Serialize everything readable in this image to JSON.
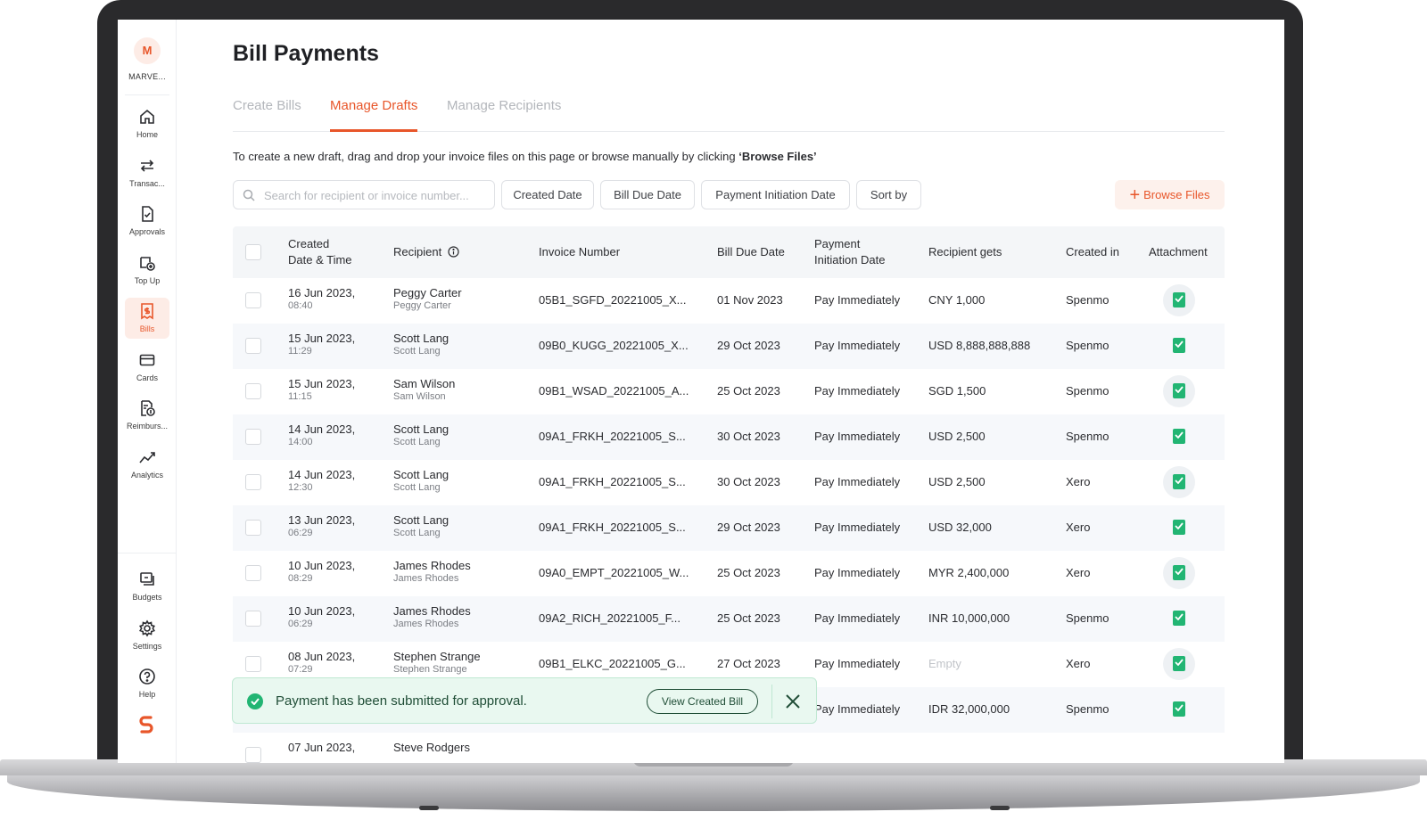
{
  "org": {
    "initial": "M",
    "name": "MARVE..."
  },
  "sidebar": {
    "items": [
      {
        "label": "Home",
        "icon": "home-icon"
      },
      {
        "label": "Transac...",
        "icon": "transactions-icon"
      },
      {
        "label": "Approvals",
        "icon": "approvals-icon"
      },
      {
        "label": "Top Up",
        "icon": "top-up-icon"
      },
      {
        "label": "Bills",
        "icon": "bills-icon",
        "active": true
      },
      {
        "label": "Cards",
        "icon": "card-icon"
      },
      {
        "label": "Reimburs...",
        "icon": "reimbursement-icon"
      },
      {
        "label": "Analytics",
        "icon": "analytics-icon"
      }
    ],
    "bottom_items": [
      {
        "label": "Budgets",
        "icon": "budgets-icon"
      },
      {
        "label": "Settings",
        "icon": "gear-icon"
      },
      {
        "label": "Help",
        "icon": "help-icon"
      }
    ]
  },
  "page": {
    "title": "Bill Payments"
  },
  "tabs": [
    {
      "label": "Create Bills"
    },
    {
      "label": "Manage Drafts",
      "active": true
    },
    {
      "label": "Manage Recipients"
    }
  ],
  "hint": {
    "text": "To create a new draft, drag and drop your invoice files on this page or browse manually by clicking ",
    "emphasis": "‘Browse Files’"
  },
  "filters": {
    "search_placeholder": "Search for recipient or invoice number...",
    "chips": [
      "Created Date",
      "Bill Due Date",
      "Payment Initiation Date",
      "Sort by"
    ],
    "browse_label": "Browse Files"
  },
  "table": {
    "headers": {
      "created_line1": "Created",
      "created_line2": "Date & Time",
      "recipient": "Recipient",
      "invoice": "Invoice Number",
      "due": "Bill Due Date",
      "payment_line1": "Payment",
      "payment_line2": "Initiation Date",
      "gets": "Recipient gets",
      "created_in": "Created in",
      "attachment": "Attachment"
    },
    "rows": [
      {
        "date": "16 Jun 2023,",
        "time": "08:40",
        "recipient": "Peggy Carter",
        "recipient_sub": "Peggy Carter",
        "invoice": "05B1_SGFD_20221005_X...",
        "due": "01 Nov 2023",
        "payment": "Pay Immediately",
        "gets": "CNY 1,000",
        "created_in": "Spenmo"
      },
      {
        "date": "15 Jun 2023,",
        "time": "11:29",
        "recipient": "Scott Lang",
        "recipient_sub": "Scott Lang",
        "invoice": "09B0_KUGG_20221005_X...",
        "due": "29 Oct 2023",
        "payment": "Pay Immediately",
        "gets": "USD 8,888,888,888",
        "created_in": "Spenmo"
      },
      {
        "date": "15 Jun 2023,",
        "time": "11:15",
        "recipient": "Sam Wilson",
        "recipient_sub": "Sam Wilson",
        "invoice": "09B1_WSAD_20221005_A...",
        "due": "25 Oct 2023",
        "payment": "Pay Immediately",
        "gets": "SGD 1,500",
        "created_in": "Spenmo"
      },
      {
        "date": "14 Jun 2023,",
        "time": "14:00",
        "recipient": "Scott Lang",
        "recipient_sub": "Scott Lang",
        "invoice": "09A1_FRKH_20221005_S...",
        "due": "30 Oct 2023",
        "payment": "Pay Immediately",
        "gets": "USD 2,500",
        "created_in": "Spenmo"
      },
      {
        "date": "14 Jun 2023,",
        "time": "12:30",
        "recipient": "Scott Lang",
        "recipient_sub": "Scott Lang",
        "invoice": "09A1_FRKH_20221005_S...",
        "due": "30 Oct 2023",
        "payment": "Pay Immediately",
        "gets": "USD 2,500",
        "created_in": "Xero"
      },
      {
        "date": "13 Jun 2023,",
        "time": "06:29",
        "recipient": "Scott Lang",
        "recipient_sub": "Scott Lang",
        "invoice": "09A1_FRKH_20221005_S...",
        "due": "29 Oct 2023",
        "payment": "Pay Immediately",
        "gets": "USD 32,000",
        "created_in": "Xero"
      },
      {
        "date": "10 Jun 2023,",
        "time": "08:29",
        "recipient": "James Rhodes",
        "recipient_sub": "James Rhodes",
        "invoice": "09A0_EMPT_20221005_W...",
        "due": "25 Oct 2023",
        "payment": "Pay Immediately",
        "gets": "MYR 2,400,000",
        "created_in": "Xero"
      },
      {
        "date": "10 Jun 2023,",
        "time": "06:29",
        "recipient": "James Rhodes",
        "recipient_sub": "James Rhodes",
        "invoice": "09A2_RICH_20221005_F...",
        "due": "25 Oct 2023",
        "payment": "Pay Immediately",
        "gets": "INR 10,000,000",
        "created_in": "Spenmo"
      },
      {
        "date": "08 Jun 2023,",
        "time": "07:29",
        "recipient": "Stephen Strange",
        "recipient_sub": "Stephen Strange",
        "invoice": "09B1_ELKC_20221005_G...",
        "due": "27 Oct 2023",
        "payment": "Pay Immediately",
        "gets": "Empty",
        "gets_muted": true,
        "created_in": "Xero"
      },
      {
        "date": "",
        "time": "",
        "recipient": "",
        "recipient_sub": "",
        "invoice": "",
        "due": "",
        "payment": "Pay Immediately",
        "gets": "IDR 32,000,000",
        "created_in": "Spenmo"
      },
      {
        "date": "07 Jun 2023,",
        "time": "",
        "recipient": "Steve Rodgers",
        "recipient_sub": "",
        "invoice": "",
        "due": "",
        "payment": "",
        "gets": "",
        "created_in": ""
      }
    ]
  },
  "toast": {
    "message": "Payment has been submitted for approval.",
    "action_label": "View Created Bill"
  },
  "colors": {
    "accent": "#e8562a",
    "success": "#22b573",
    "header_bg": "#f4f6f8"
  }
}
